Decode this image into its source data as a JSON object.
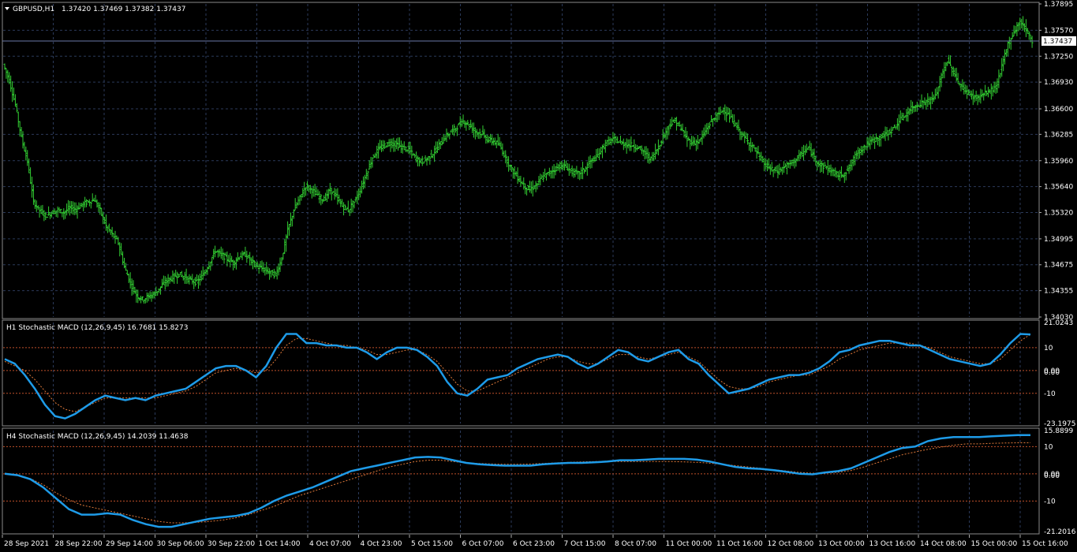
{
  "colors": {
    "background": "#000000",
    "grid": "#2b3a5a",
    "candle": "#32cd32",
    "main_line": "#1e9be8",
    "signal_line": "#e07a3a",
    "level": "#c0502a",
    "price_line": "#6a78a8"
  },
  "icons": {
    "menu": "triangle-down-icon"
  },
  "chart_data": [
    {
      "type": "candlestick",
      "title": "GBPUSD,H1",
      "ohlc_text": "1.37420 1.37469 1.37382 1.37437",
      "current_price": 1.37437,
      "current_price_label": "1.37437",
      "ylim": [
        1.3403,
        1.37895
      ],
      "y_ticks": [
        "1.37895",
        "1.37570",
        "1.37250",
        "1.36930",
        "1.36600",
        "1.36285",
        "1.35960",
        "1.35640",
        "1.35320",
        "1.34995",
        "1.34675",
        "1.34355",
        "1.34030"
      ],
      "close_path": [
        1.3715,
        1.3695,
        1.3665,
        1.3625,
        1.3595,
        1.3545,
        1.3535,
        1.3528,
        1.3532,
        1.3535,
        1.3532,
        1.3538,
        1.3536,
        1.3542,
        1.3545,
        1.3548,
        1.3535,
        1.3515,
        1.3505,
        1.3495,
        1.3465,
        1.3445,
        1.343,
        1.3425,
        1.3428,
        1.3432,
        1.344,
        1.3448,
        1.3452,
        1.3456,
        1.3452,
        1.3448,
        1.3446,
        1.3455,
        1.3468,
        1.3485,
        1.348,
        1.3475,
        1.347,
        1.3478,
        1.348,
        1.3472,
        1.3465,
        1.3462,
        1.3458,
        1.3455,
        1.3475,
        1.351,
        1.3535,
        1.355,
        1.3565,
        1.356,
        1.3552,
        1.3548,
        1.356,
        1.3552,
        1.354,
        1.3535,
        1.3545,
        1.356,
        1.358,
        1.36,
        1.361,
        1.3615,
        1.3618,
        1.3616,
        1.3612,
        1.361,
        1.36,
        1.3595,
        1.3598,
        1.3605,
        1.3615,
        1.3625,
        1.3632,
        1.3638,
        1.3645,
        1.364,
        1.3632,
        1.363,
        1.3622,
        1.362,
        1.3615,
        1.36,
        1.3585,
        1.3575,
        1.3565,
        1.356,
        1.3565,
        1.3575,
        1.358,
        1.3585,
        1.359,
        1.3588,
        1.3582,
        1.358,
        1.3585,
        1.3595,
        1.36,
        1.3612,
        1.362,
        1.3622,
        1.3618,
        1.3616,
        1.3615,
        1.3612,
        1.3605,
        1.3598,
        1.361,
        1.3625,
        1.364,
        1.3645,
        1.3635,
        1.3622,
        1.3618,
        1.362,
        1.3632,
        1.3645,
        1.3652,
        1.366,
        1.365,
        1.364,
        1.3628,
        1.362,
        1.3612,
        1.36,
        1.359,
        1.3585,
        1.3583,
        1.3588,
        1.3592,
        1.3598,
        1.3605,
        1.3612,
        1.36,
        1.359,
        1.3588,
        1.3582,
        1.3578,
        1.358,
        1.359,
        1.3605,
        1.3612,
        1.3618,
        1.3622,
        1.3625,
        1.363,
        1.3635,
        1.3645,
        1.3652,
        1.366,
        1.3665,
        1.3668,
        1.367,
        1.3675,
        1.37,
        1.372,
        1.3705,
        1.369,
        1.3682,
        1.3676,
        1.3674,
        1.3678,
        1.3682,
        1.3686,
        1.3712,
        1.374,
        1.3755,
        1.3768,
        1.3758,
        1.3744
      ]
    },
    {
      "type": "line",
      "title": "H1 Stochastic MACD (12,26,9,45) 16.7681 15.8273",
      "ylim": [
        -23.1975,
        21.0243
      ],
      "y_ticks": [
        "21.0243",
        "10",
        "0.00",
        "0.00",
        "-10",
        "-23.1975"
      ],
      "levels": [
        10,
        0,
        -10
      ],
      "series": [
        {
          "name": "main",
          "values": [
            5,
            3,
            -2,
            -8,
            -15,
            -20,
            -21,
            -19,
            -16,
            -13,
            -11,
            -12,
            -13,
            -12,
            -13,
            -11,
            -10,
            -9,
            -8,
            -5,
            -2,
            1,
            2,
            2,
            0,
            -3,
            2,
            10,
            16,
            16,
            12,
            12,
            11,
            11,
            10,
            10,
            8,
            5,
            8,
            10,
            10,
            9,
            6,
            2,
            -5,
            -10,
            -11,
            -8,
            -4,
            -3,
            -2,
            1,
            3,
            5,
            6,
            7,
            6,
            3,
            1,
            3,
            6,
            9,
            8,
            5,
            4,
            6,
            8,
            9,
            5,
            3,
            -2,
            -6,
            -10,
            -9,
            -8,
            -6,
            -4,
            -3,
            -2,
            -2,
            -1,
            1,
            4,
            8,
            9,
            11,
            12,
            13,
            13,
            12,
            11,
            11,
            9,
            7,
            5,
            4,
            3,
            2,
            3,
            7,
            12,
            16,
            15.8
          ]
        },
        {
          "name": "signal",
          "values": [
            4,
            2,
            0,
            -4,
            -9,
            -14,
            -17,
            -18,
            -16,
            -14,
            -12,
            -12,
            -12,
            -12,
            -12,
            -12,
            -11,
            -10,
            -9,
            -7,
            -4,
            -1,
            0,
            1,
            0,
            -1,
            0,
            5,
            11,
            14,
            14,
            13,
            12,
            11,
            11,
            10,
            9,
            7,
            7,
            8,
            9,
            9,
            7,
            4,
            -1,
            -6,
            -9,
            -9,
            -7,
            -5,
            -3,
            -1,
            1,
            3,
            5,
            6,
            6,
            4,
            3,
            3,
            5,
            7,
            7,
            6,
            5,
            6,
            7,
            8,
            6,
            4,
            0,
            -4,
            -7,
            -8,
            -8,
            -7,
            -5,
            -4,
            -3,
            -2,
            -2,
            0,
            2,
            5,
            7,
            9,
            10,
            11,
            12,
            12,
            12,
            11,
            10,
            8,
            6,
            5,
            4,
            3,
            3,
            5,
            9,
            13,
            15.8
          ]
        }
      ]
    },
    {
      "type": "line",
      "title": "H4 Stochastic MACD (12,26,9,45) 14.2039 11.4638",
      "ylim": [
        -21.2016,
        15.8899
      ],
      "y_ticks": [
        "15.8899",
        "10",
        "0.00",
        "0.00",
        "-10",
        "-21.2016"
      ],
      "levels": [
        10,
        0,
        -10
      ],
      "series": [
        {
          "name": "main",
          "values": [
            0,
            -0.5,
            -2,
            -5,
            -9,
            -13,
            -15,
            -15,
            -14.5,
            -15,
            -17,
            -18.5,
            -19.5,
            -19.5,
            -18.5,
            -17.5,
            -16.5,
            -16,
            -15.5,
            -14.5,
            -12.5,
            -10,
            -8,
            -6.5,
            -5,
            -3,
            -1,
            1,
            2,
            3,
            4,
            5,
            6,
            6.2,
            6,
            5,
            4,
            3.5,
            3.2,
            3,
            3,
            3,
            3.5,
            3.8,
            4,
            4,
            4.2,
            4.5,
            5,
            5,
            5.2,
            5.5,
            5.5,
            5.5,
            5.2,
            4.5,
            3.5,
            2.5,
            2,
            1.8,
            1.3,
            0.7,
            0,
            -0.2,
            0.5,
            1,
            2,
            4,
            6,
            8,
            9.5,
            10,
            12,
            13,
            13.5,
            13.5,
            13.5,
            13.8,
            14,
            14.2,
            14.2
          ]
        },
        {
          "name": "signal",
          "values": [
            0.2,
            -0.4,
            -1.8,
            -4,
            -7,
            -9.5,
            -11.5,
            -12.5,
            -13.5,
            -14.5,
            -15.5,
            -16.5,
            -17.5,
            -18,
            -18,
            -17.8,
            -17.5,
            -17,
            -16.2,
            -15,
            -13.5,
            -12,
            -10,
            -8,
            -6.5,
            -5,
            -3.5,
            -2,
            -0.5,
            1,
            2.5,
            3.5,
            4.5,
            5,
            5,
            4.5,
            4,
            3.8,
            3.6,
            3.5,
            3.5,
            3.6,
            3.8,
            4,
            4.2,
            4.4,
            4.5,
            4.5,
            4.5,
            4.5,
            4.5,
            4.5,
            4.5,
            4.4,
            4.2,
            3.9,
            3.5,
            3,
            2.5,
            2,
            1.5,
            1,
            0.5,
            0.2,
            0.3,
            0.6,
            1.2,
            2.5,
            4,
            5.5,
            7,
            8,
            9,
            9.8,
            10.5,
            11,
            11,
            11.2,
            11.3,
            11.4,
            11.4
          ]
        }
      ]
    }
  ],
  "x_axis": {
    "labels": [
      "28 Sep 2021",
      "28 Sep 22:00",
      "29 Sep 14:00",
      "30 Sep 06:00",
      "30 Sep 22:00",
      "1 Oct 14:00",
      "4 Oct 07:00",
      "4 Oct 23:00",
      "5 Oct 15:00",
      "6 Oct 07:00",
      "6 Oct 23:00",
      "7 Oct 15:00",
      "8 Oct 07:00",
      "11 Oct 00:00",
      "11 Oct 16:00",
      "12 Oct 08:00",
      "13 Oct 00:00",
      "13 Oct 16:00",
      "14 Oct 08:00",
      "15 Oct 00:00",
      "15 Oct 16:00"
    ]
  }
}
